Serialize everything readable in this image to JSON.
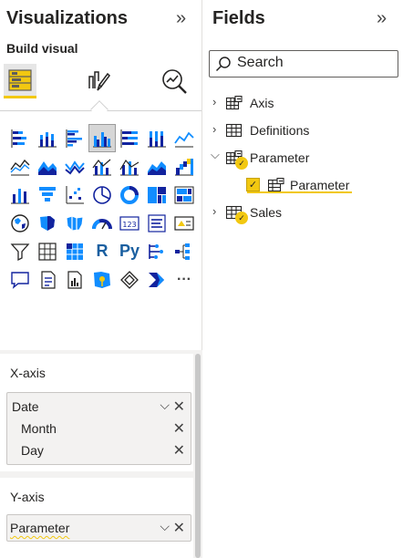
{
  "visualizations": {
    "title": "Visualizations",
    "collapse_glyph": "»",
    "build_visual_label": "Build visual",
    "build_icons": [
      "build-visual-icon",
      "format-visual-icon",
      "analytics-icon"
    ],
    "gallery_text_tiles": {
      "r": "R",
      "py": "Py",
      "more": "···"
    },
    "wells": {
      "xaxis": {
        "title": "X-axis",
        "fields": [
          {
            "label": "Date",
            "expandable": true
          },
          {
            "label": "Month",
            "expandable": false
          },
          {
            "label": "Day",
            "expandable": false
          }
        ]
      },
      "yaxis": {
        "title": "Y-axis",
        "fields": [
          {
            "label": "Parameter",
            "expandable": true
          }
        ]
      }
    }
  },
  "fields": {
    "title": "Fields",
    "collapse_glyph": "»",
    "search": {
      "placeholder": "Search",
      "value": ""
    },
    "tables": [
      {
        "name": "Axis",
        "expanded": false,
        "has_selection": false
      },
      {
        "name": "Definitions",
        "expanded": false,
        "has_selection": false
      },
      {
        "name": "Parameter",
        "expanded": true,
        "has_selection": true,
        "children": [
          {
            "name": "Parameter",
            "checked": true
          }
        ]
      },
      {
        "name": "Sales",
        "expanded": false,
        "has_selection": true
      }
    ]
  },
  "colors": {
    "accent": "#f2c811",
    "chart_blue": "#118dff",
    "chart_dark": "#12239e",
    "pane_bg": "#ffffff",
    "well_bg": "#f3f2f1"
  }
}
